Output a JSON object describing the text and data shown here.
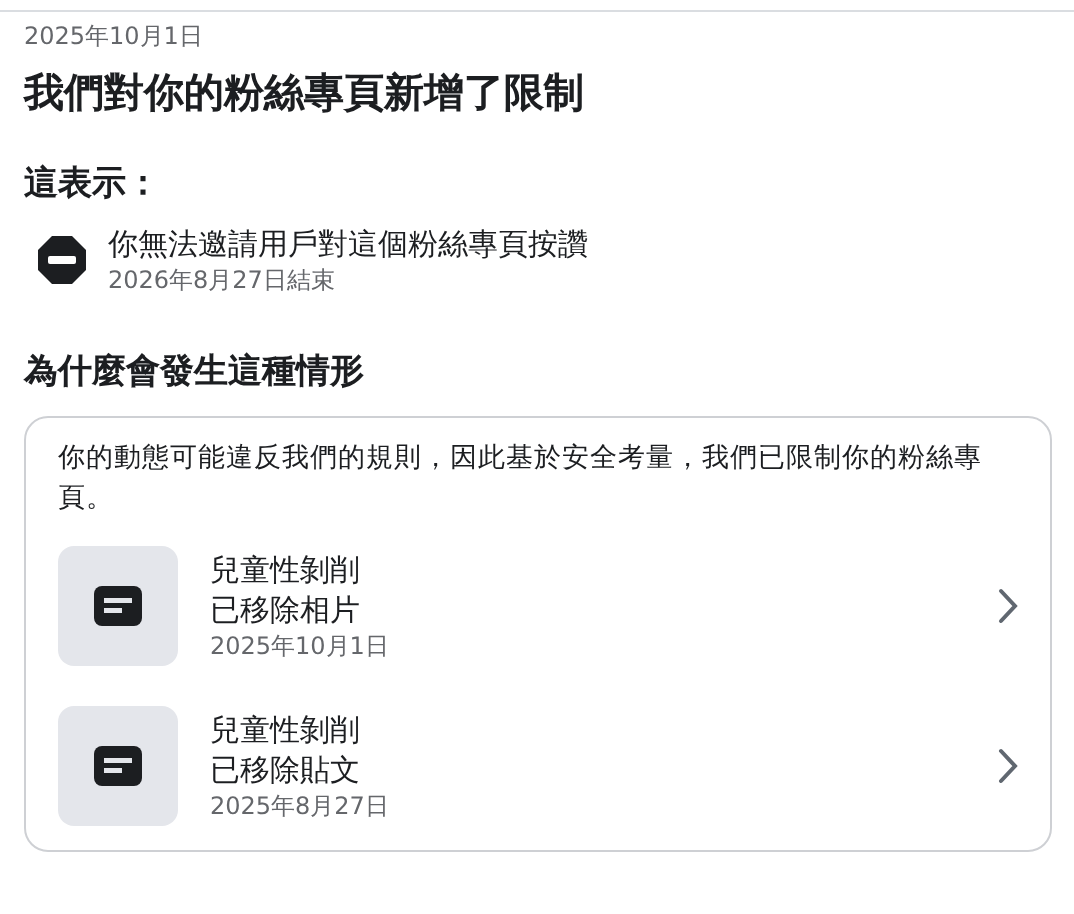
{
  "date": "2025年10月1日",
  "title": "我們對你的粉絲專頁新增了限制",
  "meaning": {
    "heading": "這表示：",
    "items": [
      {
        "text": "你無法邀請用戶對這個粉絲專頁按讚",
        "subtext": "2026年8月27日結束"
      }
    ]
  },
  "reason": {
    "heading": "為什麼會發生這種情形",
    "description": "你的動態可能違反我們的規則，因此基於安全考量，我們已限制你的粉絲專頁。",
    "items": [
      {
        "title": "兒童性剝削",
        "action": "已移除相片",
        "date": "2025年10月1日"
      },
      {
        "title": "兒童性剝削",
        "action": "已移除貼文",
        "date": "2025年8月27日"
      }
    ]
  }
}
